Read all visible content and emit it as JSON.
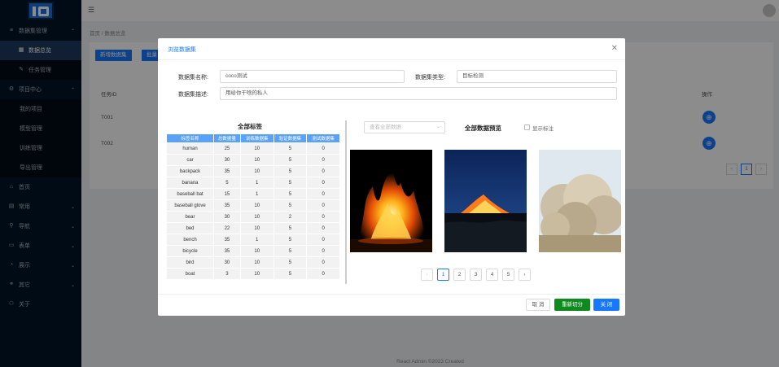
{
  "sidebar": {
    "items": [
      {
        "label": "数据集管理",
        "icon": "list-icon",
        "arrow": "⌃"
      },
      {
        "label": "数据总览",
        "icon": "chart-icon",
        "sub": true,
        "active": true
      },
      {
        "label": "任务管理",
        "icon": "edit-icon",
        "sub": true
      },
      {
        "label": "项目中心",
        "icon": "gear-icon",
        "arrow": "⌃"
      },
      {
        "label": "我的项目",
        "sub2": true
      },
      {
        "label": "模型管理",
        "sub2": true
      },
      {
        "label": "训练管理",
        "sub2": true
      },
      {
        "label": "导出管理",
        "sub2": true
      },
      {
        "label": "首页",
        "icon": "home-icon"
      },
      {
        "label": "常用",
        "icon": "grid-icon",
        "arrow": "⌄"
      },
      {
        "label": "导航",
        "icon": "pin-icon",
        "arrow": "⌄"
      },
      {
        "label": "表单",
        "icon": "form-icon",
        "arrow": "⌄"
      },
      {
        "label": "展示",
        "icon": "display-icon",
        "arrow": "⌄"
      },
      {
        "label": "其它",
        "icon": "link-icon",
        "arrow": "⌄"
      },
      {
        "label": "关于",
        "icon": "user-icon"
      }
    ]
  },
  "header": {
    "breadcrumb": "首页 / 数据总览"
  },
  "background": {
    "buttons": [
      "新增数据集",
      "批量"
    ],
    "col_task_id": "任务ID",
    "col_ops": "操作",
    "rows": [
      "T001",
      "T002"
    ],
    "page": "1"
  },
  "footer": "React Admin ©2023 Created",
  "modal": {
    "title": "浏览数据集",
    "name_label": "数据集名称:",
    "name_value": "coco测试",
    "type_label": "数据集类型:",
    "type_value": "目标检测",
    "desc_label": "数据集描述:",
    "desc_value": "用给你干啥的私人",
    "table_title": "全部标签",
    "table_headers": [
      "标签名称",
      "总数据量",
      "训练数据集",
      "验证数据集",
      "测试数据集"
    ],
    "table_rows": [
      [
        "human",
        "25",
        "10",
        "5",
        "0"
      ],
      [
        "car",
        "30",
        "10",
        "5",
        "0"
      ],
      [
        "backpack",
        "35",
        "10",
        "5",
        "0"
      ],
      [
        "banana",
        "5",
        "1",
        "5",
        "0"
      ],
      [
        "baseball bat",
        "15",
        "1",
        "5",
        "0"
      ],
      [
        "baseball glove",
        "35",
        "10",
        "5",
        "0"
      ],
      [
        "bear",
        "30",
        "10",
        "2",
        "0"
      ],
      [
        "bed",
        "22",
        "10",
        "5",
        "0"
      ],
      [
        "bench",
        "35",
        "1",
        "5",
        "0"
      ],
      [
        "bicycle",
        "35",
        "10",
        "5",
        "0"
      ],
      [
        "bird",
        "30",
        "10",
        "5",
        "0"
      ],
      [
        "boat",
        "3",
        "10",
        "5",
        "0"
      ]
    ],
    "select_placeholder": "查看全部数据",
    "preview_title": "全部数据预览",
    "show_label": "显示标注",
    "pages": [
      "1",
      "2",
      "3",
      "4",
      "5"
    ],
    "current_page": "1",
    "cancel": "取 消",
    "resplit": "重新切分",
    "close": "关 闭"
  }
}
